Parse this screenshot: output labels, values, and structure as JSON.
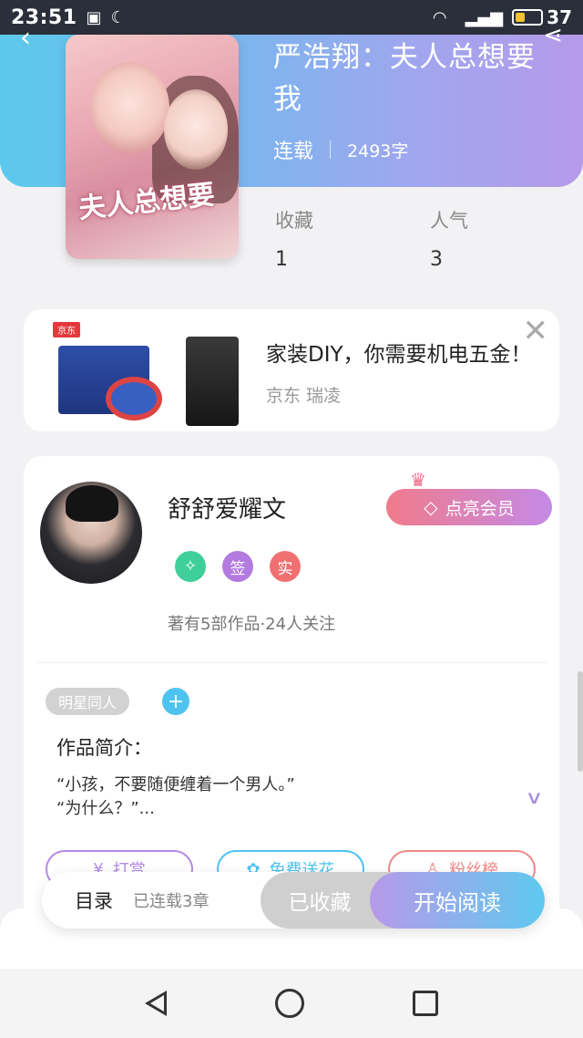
{
  "status_bar": {
    "time": "23:51",
    "battery": "37",
    "battery_level": 0.37
  },
  "book": {
    "title": "严浩翔：夫人总想要我",
    "cover_title": "夫人总想要",
    "status": "连载",
    "word_count": "2493字"
  },
  "stats": [
    {
      "label": "收藏",
      "value": "1"
    },
    {
      "label": "人气",
      "value": "3"
    }
  ],
  "ad": {
    "logo": "京东",
    "title": "家装DIY，你需要机电五金！",
    "subtitle": "京东 瑞凌",
    "close": "✕"
  },
  "author": {
    "name": "舒舒爱耀文",
    "vip_label": "点亮会员",
    "badges": [
      "签",
      "实"
    ],
    "works": "著有5部作品·24人关注"
  },
  "tag": "明星同人",
  "intro": {
    "heading": "作品简介：",
    "line1": "“小孩，不要随便缠着一个男人。”",
    "line2": "“为什么？”..."
  },
  "actions": {
    "reward": "打赏",
    "flower": "免费送花",
    "fans": "粉丝榜"
  },
  "bottom": {
    "toc": "目录",
    "chapters": "已连载3章",
    "favorited": "已收藏",
    "read": "开始阅读"
  },
  "icons": {
    "back": "back-icon",
    "share": "share-icon",
    "crown": "crown-icon",
    "gem": "gem-icon",
    "expand": "chevron-down-icon"
  },
  "colors": {
    "hero_start": "#5cc9ec",
    "hero_end": "#b59ae9",
    "vip_start": "#f07b8b",
    "vip_end": "#c48ae6",
    "read_start": "#b79ae9",
    "read_end": "#5fc9ef"
  }
}
